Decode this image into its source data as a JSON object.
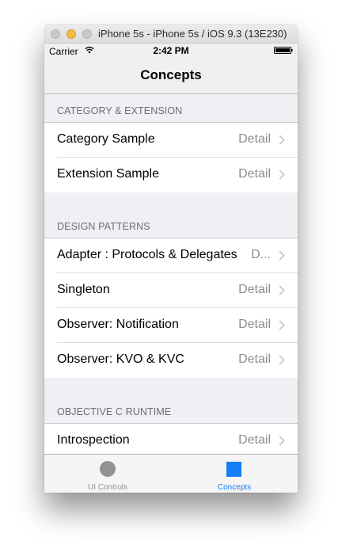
{
  "window": {
    "title": "iPhone 5s - iPhone 5s / iOS 9.3 (13E230)"
  },
  "status_bar": {
    "carrier": "Carrier",
    "time": "2:42 PM",
    "wifi_icon": "wifi-icon",
    "battery_icon": "battery-icon"
  },
  "nav": {
    "title": "Concepts"
  },
  "sections": [
    {
      "header": "CATEGORY & EXTENSION",
      "rows": [
        {
          "title": "Category Sample",
          "detail": "Detail"
        },
        {
          "title": "Extension Sample",
          "detail": "Detail"
        }
      ]
    },
    {
      "header": "DESIGN PATTERNS",
      "rows": [
        {
          "title": "Adapter : Protocols & Delegates",
          "detail": "D..."
        },
        {
          "title": "Singleton",
          "detail": "Detail"
        },
        {
          "title": "Observer: Notification",
          "detail": "Detail"
        },
        {
          "title": "Observer: KVO & KVC",
          "detail": "Detail"
        }
      ]
    },
    {
      "header": "OBJECTIVE C RUNTIME",
      "rows": [
        {
          "title": "Introspection",
          "detail": "Detail"
        }
      ]
    }
  ],
  "tabbar": {
    "tabs": [
      {
        "label": "UI Controls",
        "icon": "circle-icon",
        "selected": false
      },
      {
        "label": "Concepts",
        "icon": "square-icon",
        "selected": true
      }
    ]
  },
  "colors": {
    "tint": "#147efb",
    "inactive": "#929292",
    "detail": "#8e8e93",
    "section_header": "#6d6d72",
    "grouped_background": "#efeff4",
    "minimize_button": "#f5b945"
  }
}
